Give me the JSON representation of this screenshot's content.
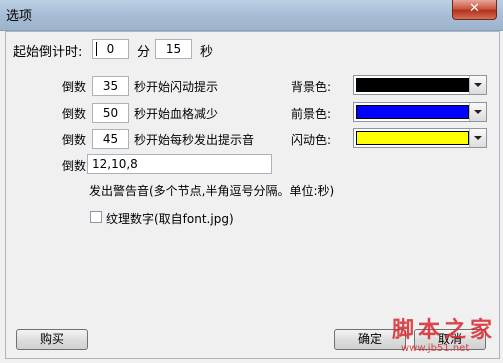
{
  "window": {
    "title": "选项",
    "close_glyph": "✕"
  },
  "countdown": {
    "label": "起始倒计时:",
    "minutes": "0",
    "min_unit": "分",
    "seconds": "15",
    "sec_unit": "秒"
  },
  "rows": [
    {
      "prefix": "倒数",
      "value": "35",
      "suffix": "秒开始闪动提示"
    },
    {
      "prefix": "倒数",
      "value": "50",
      "suffix": "秒开始血格减少"
    },
    {
      "prefix": "倒数",
      "value": "45",
      "suffix": "秒开始每秒发出提示音"
    },
    {
      "prefix": "倒数",
      "value": "12,10,8"
    }
  ],
  "colors": [
    {
      "label": "背景色:",
      "color": "#000000"
    },
    {
      "label": "前景色:",
      "color": "#0000ff"
    },
    {
      "label": "闪动色:",
      "color": "#ffff00"
    }
  ],
  "hint": "发出警告音(多个节点,半角逗号分隔。单位:秒)",
  "texture_checkbox": {
    "label": "纹理数字(取自font.jpg)",
    "checked": false
  },
  "buttons": {
    "buy": "购买",
    "ok": "确定",
    "cancel": "取消"
  },
  "watermark": {
    "text": "脚本之家",
    "url": "www.jb51.net"
  }
}
